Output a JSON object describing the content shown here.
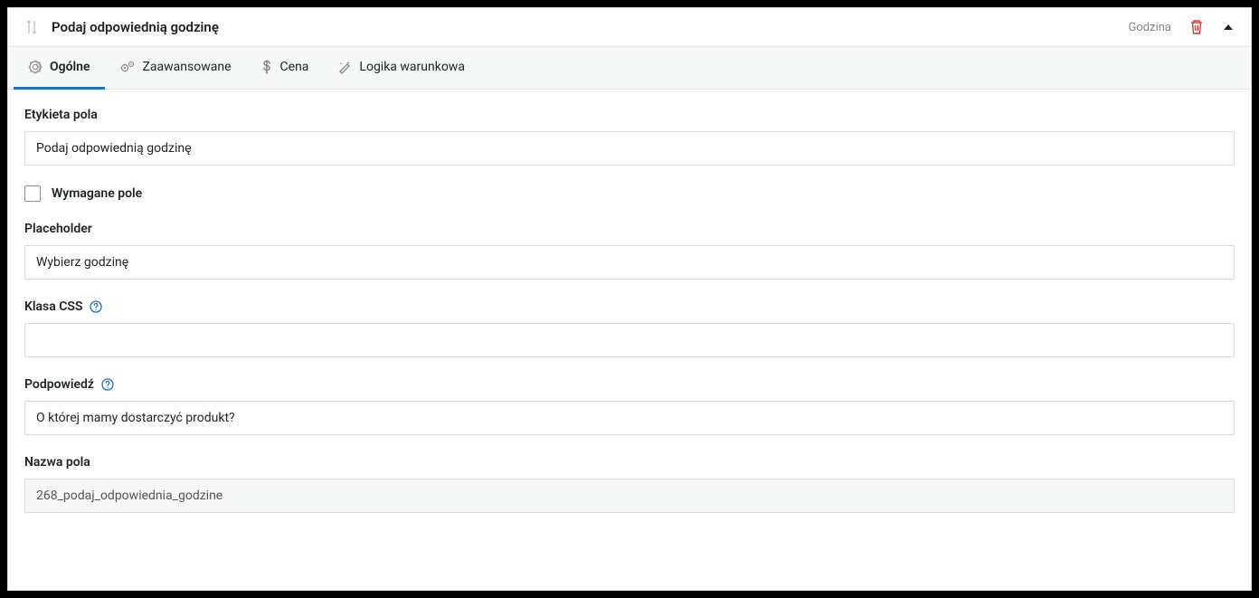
{
  "header": {
    "title": "Podaj odpowiednią godzinę",
    "field_type": "Godzina"
  },
  "tabs": {
    "general": "Ogólne",
    "advanced": "Zaawansowane",
    "price": "Cena",
    "conditional": "Logika warunkowa"
  },
  "fields": {
    "label": {
      "title": "Etykieta pola",
      "value": "Podaj odpowiednią godzinę"
    },
    "required": {
      "title": "Wymagane pole"
    },
    "placeholder": {
      "title": "Placeholder",
      "value": "Wybierz godzinę"
    },
    "css_class": {
      "title": "Klasa CSS",
      "value": ""
    },
    "hint": {
      "title": "Podpowiedź",
      "value": "O której mamy dostarczyć produkt?"
    },
    "field_name": {
      "title": "Nazwa pola",
      "value": "268_podaj_odpowiednia_godzine"
    }
  }
}
